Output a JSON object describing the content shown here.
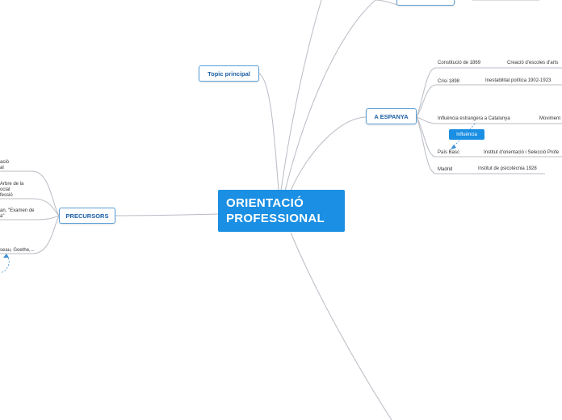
{
  "central": {
    "line1": "ORIENTACIÓ",
    "line2": "PROFESSIONAL"
  },
  "topics": {
    "topic_principal": "Topic principal",
    "a_espanya": "A ESPANYA",
    "precursors": "PRECURSORS"
  },
  "espanya_items": {
    "constitucio": "Constitució de 1869",
    "creacio_escoles": "Creació d'escoles d'arts",
    "crisi": "Crisi 1898",
    "inestabilitat": "Inestabilitat política 1902-1923",
    "influencia_estrangera": "Influència estrangera  a Catalunya",
    "moviment": "Moviment",
    "pais_basc": "País Basc",
    "institut_orientacio": "Institut d'orientació i Selecció Profe",
    "madrid": "Madrid",
    "institut_psicotecnia": "Institut de psicotècnia 1928"
  },
  "influencia_badge": "Influència",
  "precursors_items": {
    "item1": [
      "ació",
      "al"
    ],
    "item2": [
      "Arbre de la",
      "ocial",
      "fessió"
    ],
    "item3": [
      "an, \"Examen de",
      "a\""
    ],
    "item4": [
      "seau, Goethe,..."
    ]
  },
  "colors": {
    "accent": "#1a8fe3",
    "topic_border": "#5aa0d8",
    "topic_text": "#1c5fa6",
    "connector": "#b8bcc4",
    "dashed_link": "#3a8fd6"
  }
}
